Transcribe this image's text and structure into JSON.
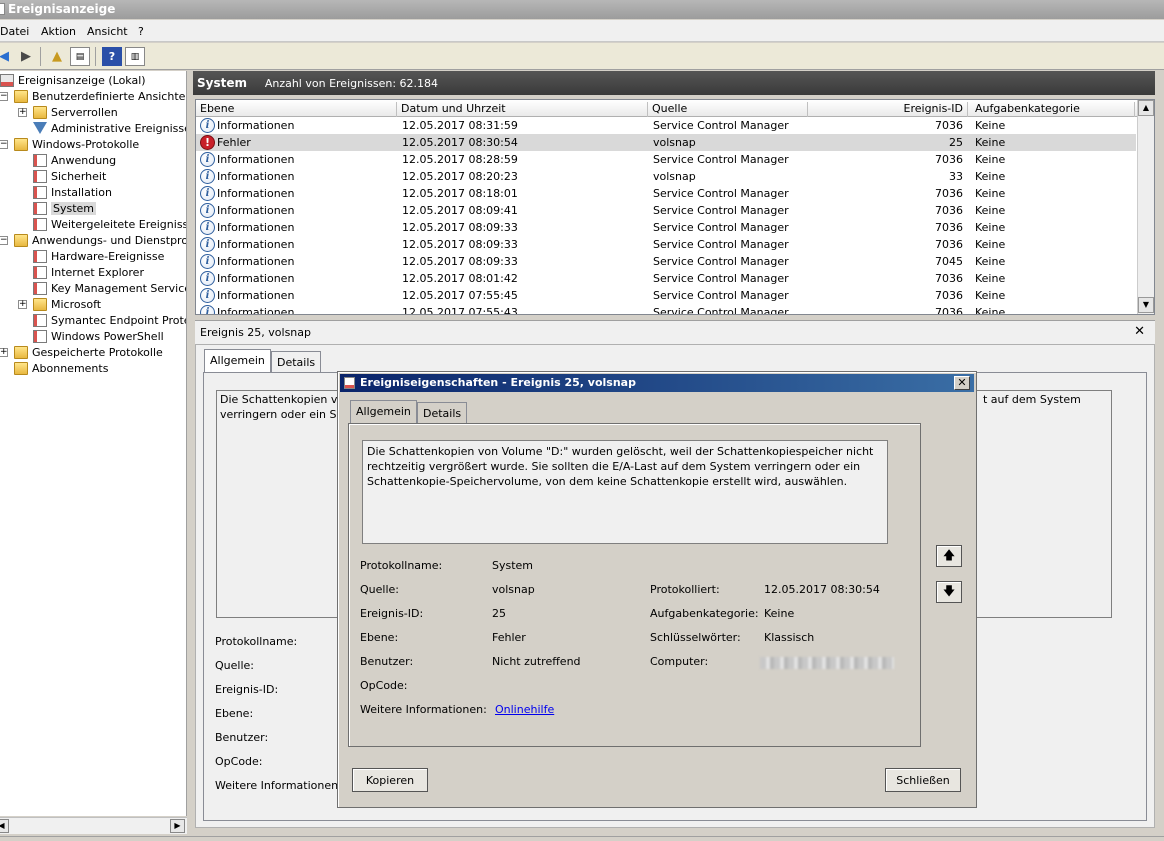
{
  "window": {
    "title": "Ereignisanzeige"
  },
  "menu": [
    "Datei",
    "Aktion",
    "Ansicht",
    "?"
  ],
  "toolbar": {
    "buttons": [
      "back-icon",
      "forward-icon",
      "up-folder-icon",
      "show-hide-tree-icon",
      "help-icon",
      "show-hide-action-pane-icon"
    ]
  },
  "tree": {
    "root": "Ereignisanzeige (Lokal)",
    "custom_views": "Benutzerdefinierte Ansichten",
    "server_roles": "Serverrollen",
    "admin_events": "Administrative Ereignisse",
    "windows_logs": "Windows-Protokolle",
    "application": "Anwendung",
    "security": "Sicherheit",
    "setup": "Installation",
    "system": "System",
    "forwarded": "Weitergeleitete Ereignisse",
    "apps_services": "Anwendungs- und Dienstprotok",
    "hardware": "Hardware-Ereignisse",
    "ie": "Internet Explorer",
    "kms": "Key Management Service",
    "microsoft": "Microsoft",
    "symantec": "Symantec Endpoint Protecti",
    "powershell": "Windows PowerShell",
    "saved_logs": "Gespeicherte Protokolle",
    "subscriptions": "Abonnements"
  },
  "main": {
    "log_name": "System",
    "event_count": "Anzahl von Ereignissen: 62.184",
    "columns": [
      "Ebene",
      "Datum und Uhrzeit",
      "Quelle",
      "Ereignis-ID",
      "Aufgabenkategorie"
    ],
    "rows": [
      {
        "level": "Informationen",
        "icon": "info-icon",
        "datetime": "12.05.2017 08:31:59",
        "source": "Service Control Manager",
        "id": "7036",
        "category": "Keine"
      },
      {
        "level": "Fehler",
        "icon": "error-icon",
        "datetime": "12.05.2017 08:30:54",
        "source": "volsnap",
        "id": "25",
        "category": "Keine"
      },
      {
        "level": "Informationen",
        "icon": "info-icon",
        "datetime": "12.05.2017 08:28:59",
        "source": "Service Control Manager",
        "id": "7036",
        "category": "Keine"
      },
      {
        "level": "Informationen",
        "icon": "info-icon",
        "datetime": "12.05.2017 08:20:23",
        "source": "volsnap",
        "id": "33",
        "category": "Keine"
      },
      {
        "level": "Informationen",
        "icon": "info-icon",
        "datetime": "12.05.2017 08:18:01",
        "source": "Service Control Manager",
        "id": "7036",
        "category": "Keine"
      },
      {
        "level": "Informationen",
        "icon": "info-icon",
        "datetime": "12.05.2017 08:09:41",
        "source": "Service Control Manager",
        "id": "7036",
        "category": "Keine"
      },
      {
        "level": "Informationen",
        "icon": "info-icon",
        "datetime": "12.05.2017 08:09:33",
        "source": "Service Control Manager",
        "id": "7036",
        "category": "Keine"
      },
      {
        "level": "Informationen",
        "icon": "info-icon",
        "datetime": "12.05.2017 08:09:33",
        "source": "Service Control Manager",
        "id": "7036",
        "category": "Keine"
      },
      {
        "level": "Informationen",
        "icon": "info-icon",
        "datetime": "12.05.2017 08:09:33",
        "source": "Service Control Manager",
        "id": "7045",
        "category": "Keine"
      },
      {
        "level": "Informationen",
        "icon": "info-icon",
        "datetime": "12.05.2017 08:01:42",
        "source": "Service Control Manager",
        "id": "7036",
        "category": "Keine"
      },
      {
        "level": "Informationen",
        "icon": "info-icon",
        "datetime": "12.05.2017 07:55:45",
        "source": "Service Control Manager",
        "id": "7036",
        "category": "Keine"
      },
      {
        "level": "Informationen",
        "icon": "info-icon",
        "datetime": "12.05.2017 07:55:43",
        "source": "Service Control Manager",
        "id": "7036",
        "category": "Keine"
      }
    ]
  },
  "detail": {
    "header": "Ereignis 25, volsnap",
    "tabs": [
      "Allgemein",
      "Details"
    ],
    "text_left_line1": "Die Schattenkopien vo",
    "text_left_line2": "verringern oder ein Sc",
    "text_right": "t auf dem System",
    "labels": [
      "Protokollname:",
      "Quelle:",
      "Ereignis-ID:",
      "Ebene:",
      "Benutzer:",
      "OpCode:",
      "Weitere Informationen"
    ]
  },
  "dialog": {
    "title": "Ereigniseigenschaften - Ereignis 25, volsnap",
    "tabs": [
      "Allgemein",
      "Details"
    ],
    "description": "Die Schattenkopien von Volume \"D:\" wurden gelöscht, weil der Schattenkopiespeicher nicht rechtzeitig vergrößert wurde. Sie sollten die E/A-Last auf dem System verringern oder ein Schattenkopie-Speichervolume, von dem keine Schattenkopie erstellt wird, auswählen.",
    "fields": {
      "log_name_label": "Protokollname:",
      "log_name": "System",
      "source_label": "Quelle:",
      "source": "volsnap",
      "logged_label": "Protokolliert:",
      "logged": "12.05.2017 08:30:54",
      "event_id_label": "Ereignis-ID:",
      "event_id": "25",
      "task_category_label": "Aufgabenkategorie:",
      "task_category": "Keine",
      "level_label": "Ebene:",
      "level": "Fehler",
      "keywords_label": "Schlüsselwörter:",
      "keywords": "Klassisch",
      "user_label": "Benutzer:",
      "user": "Nicht zutreffend",
      "computer_label": "Computer:",
      "opcode_label": "OpCode:",
      "more_info_label": "Weitere Informationen:",
      "more_info_link": "Onlinehilfe"
    },
    "copy_button": "Kopieren",
    "close_button": "Schließen"
  }
}
